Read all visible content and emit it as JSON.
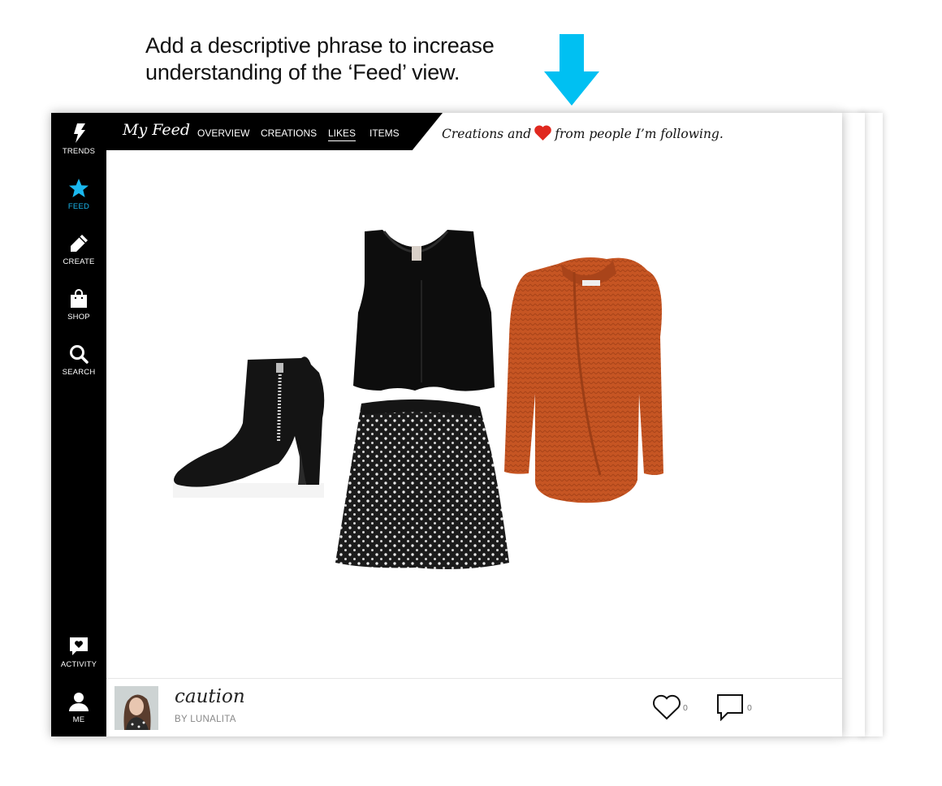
{
  "annotation": {
    "line1": "Add a descriptive phrase to increase",
    "line2": "understanding of the ‘Feed’ view.",
    "arrow_color": "#00c0f2"
  },
  "sidebar": {
    "items": [
      {
        "label": "TRENDS",
        "icon": "lightning-icon"
      },
      {
        "label": "FEED",
        "icon": "star-icon",
        "active": true
      },
      {
        "label": "CREATE",
        "icon": "pencil-icon"
      },
      {
        "label": "SHOP",
        "icon": "shopping-bag-icon"
      },
      {
        "label": "SEARCH",
        "icon": "search-icon"
      },
      {
        "label": "ACTIVITY",
        "icon": "heart-chat-icon"
      },
      {
        "label": "ME",
        "icon": "person-icon"
      }
    ],
    "active_color": "#1ab8ef"
  },
  "header": {
    "title": "My Feed",
    "tabs": [
      {
        "label": "OVERVIEW"
      },
      {
        "label": "CREATIONS"
      },
      {
        "label": "LIKES",
        "active": true
      },
      {
        "label": "ITEMS"
      }
    ],
    "tagline_before": "Creations and",
    "tagline_after": "from people I’m following.",
    "heart_color": "#e0281f"
  },
  "post": {
    "title": "caution",
    "author": "BY LUNALITA",
    "likes": "0",
    "comments": "0",
    "items": [
      "ankle-boot-image",
      "black-tank-top-image",
      "floral-skirt-image",
      "orange-cardigan-image"
    ]
  }
}
